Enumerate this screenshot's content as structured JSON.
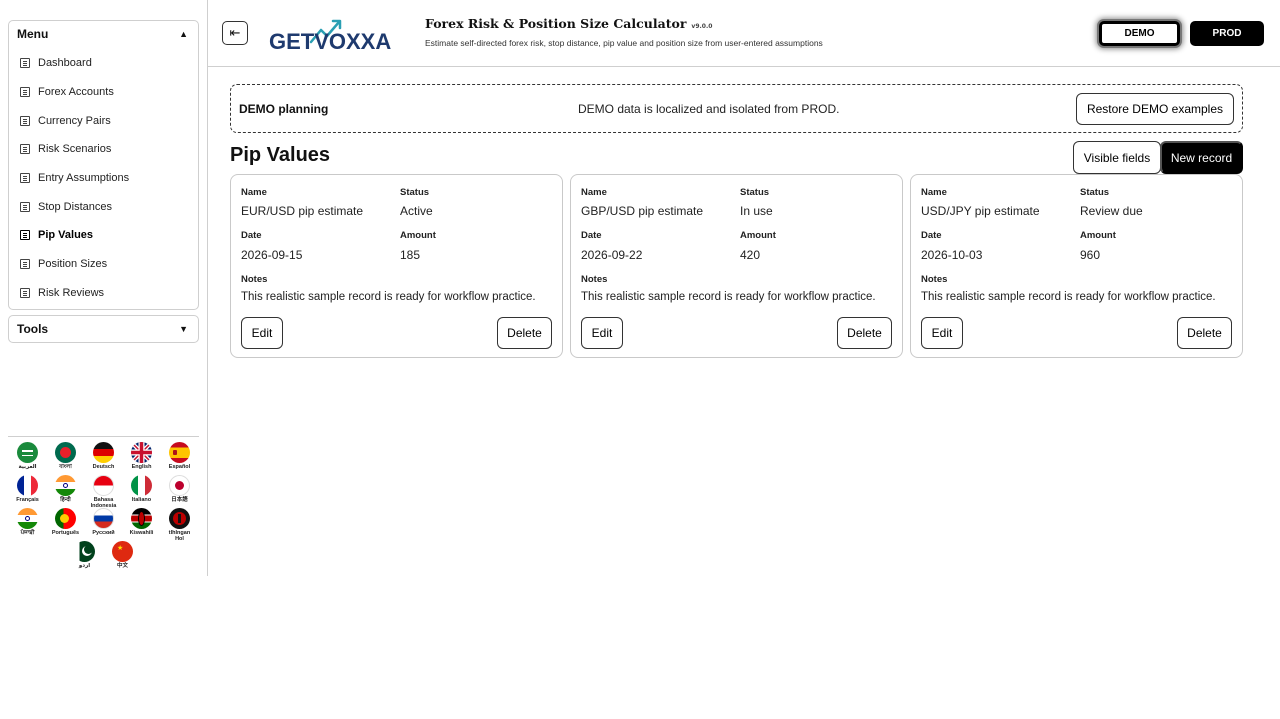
{
  "sidebar": {
    "menu_title": "Menu",
    "tools_title": "Tools",
    "items": [
      {
        "label": "Dashboard"
      },
      {
        "label": "Forex Accounts"
      },
      {
        "label": "Currency Pairs"
      },
      {
        "label": "Risk Scenarios"
      },
      {
        "label": "Entry Assumptions"
      },
      {
        "label": "Stop Distances"
      },
      {
        "label": "Pip Values",
        "active": true
      },
      {
        "label": "Position Sizes"
      },
      {
        "label": "Risk Reviews"
      }
    ],
    "languages": [
      {
        "label": "العربية",
        "icon": "flag-saudi-arabia-icon"
      },
      {
        "label": "বাংলা",
        "icon": "flag-bangladesh-icon"
      },
      {
        "label": "Deutsch",
        "icon": "flag-germany-icon"
      },
      {
        "label": "English",
        "icon": "flag-uk-icon"
      },
      {
        "label": "Español",
        "icon": "flag-spain-icon"
      },
      {
        "label": "Français",
        "icon": "flag-france-icon"
      },
      {
        "label": "हिन्दी",
        "icon": "flag-india-icon"
      },
      {
        "label": "Bahasa Indonesia",
        "icon": "flag-indonesia-icon"
      },
      {
        "label": "Italiano",
        "icon": "flag-italy-icon"
      },
      {
        "label": "日本語",
        "icon": "flag-japan-icon"
      },
      {
        "label": "ਪੰਜਾਬੀ",
        "icon": "flag-india-icon"
      },
      {
        "label": "Português",
        "icon": "flag-portugal-icon"
      },
      {
        "label": "Русский",
        "icon": "flag-russia-icon"
      },
      {
        "label": "Kiswahili",
        "icon": "flag-kenya-icon"
      },
      {
        "label": "tlhIngan Hol",
        "icon": "flag-klingon-icon"
      },
      {
        "label": "اردو",
        "icon": "flag-pakistan-icon"
      },
      {
        "label": "中文",
        "icon": "flag-china-icon"
      }
    ]
  },
  "header": {
    "logo_text": "GETVOXXA",
    "title": "Forex Risk & Position Size Calculator",
    "version": "v9.0.0",
    "subtitle": "Estimate self-directed forex risk, stop distance, pip value and position size from user-entered assumptions",
    "demo_label": "DEMO",
    "prod_label": "PROD"
  },
  "banner": {
    "title": "DEMO planning",
    "message": "DEMO data is localized and isolated from PROD.",
    "restore_label": "Restore DEMO examples"
  },
  "main": {
    "page_title": "Pip Values",
    "visible_fields_label": "Visible fields",
    "new_record_label": "New record",
    "field_labels": {
      "name": "Name",
      "status": "Status",
      "date": "Date",
      "amount": "Amount",
      "notes": "Notes"
    },
    "edit_label": "Edit",
    "delete_label": "Delete",
    "records": [
      {
        "name": "EUR/USD pip estimate",
        "status": "Active",
        "date": "2026-09-15",
        "amount": "185",
        "notes": "This realistic sample record is ready for workflow practice."
      },
      {
        "name": "GBP/USD pip estimate",
        "status": "In use",
        "date": "2026-09-22",
        "amount": "420",
        "notes": "This realistic sample record is ready for workflow practice."
      },
      {
        "name": "USD/JPY pip estimate",
        "status": "Review due",
        "date": "2026-10-03",
        "amount": "960",
        "notes": "This realistic sample record is ready for workflow practice."
      }
    ]
  },
  "colors": {
    "accent": "#000000",
    "logo_navy": "#1e3a6e",
    "logo_teal": "#2a9fb3",
    "border": "#cfcfcf"
  }
}
